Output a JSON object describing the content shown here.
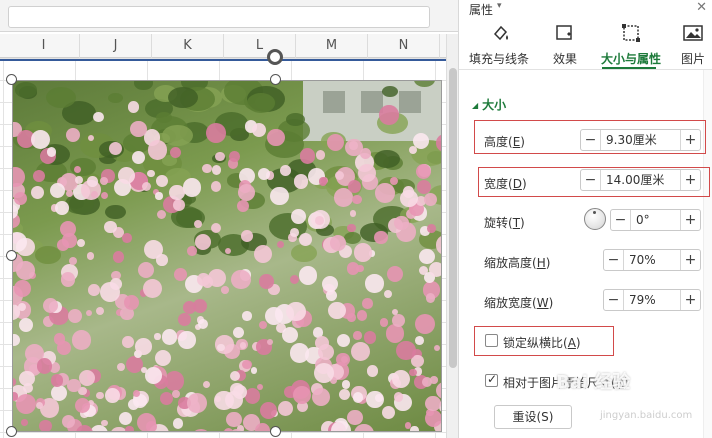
{
  "sheet": {
    "columns": [
      "I",
      "J",
      "K",
      "L",
      "M",
      "N"
    ]
  },
  "panel": {
    "title": "属性",
    "close_icon": "close-icon",
    "tabs": [
      {
        "label": "填充与线条",
        "icon": "fill-line-icon",
        "active": false
      },
      {
        "label": "效果",
        "icon": "effect-icon",
        "active": false
      },
      {
        "label": "大小与属性",
        "icon": "size-property-icon",
        "active": true
      },
      {
        "label": "图片",
        "icon": "picture-icon",
        "active": false
      }
    ],
    "section_title": "大小",
    "height": {
      "label": "高度(",
      "key": "E",
      "suffix": ")",
      "value": "9.30厘米"
    },
    "width": {
      "label": "宽度(",
      "key": "D",
      "suffix": ")",
      "value": "14.00厘米"
    },
    "rotation": {
      "label": "旋转(",
      "key": "T",
      "suffix": ")",
      "value": "0°"
    },
    "scale_height": {
      "label": "缩放高度(",
      "key": "H",
      "suffix": ")",
      "value": "70%"
    },
    "scale_width": {
      "label": "缩放宽度(",
      "key": "W",
      "suffix": ")",
      "value": "79%"
    },
    "lock_aspect": {
      "label": "锁定纵横比(",
      "key": "A",
      "suffix": ")",
      "checked": false
    },
    "relative_original": {
      "label": "相对于图片原始尺寸(",
      "key": "R",
      "suffix": ")",
      "checked": true
    },
    "reset_button": "重设(S)"
  },
  "spinner": {
    "minus": "−",
    "plus": "+"
  },
  "watermark": {
    "text": "Bai 经验",
    "sub": "jingyan.baidu.com"
  },
  "colors": {
    "accent": "#1d7a3a",
    "highlight_box": "#d24a4a"
  }
}
